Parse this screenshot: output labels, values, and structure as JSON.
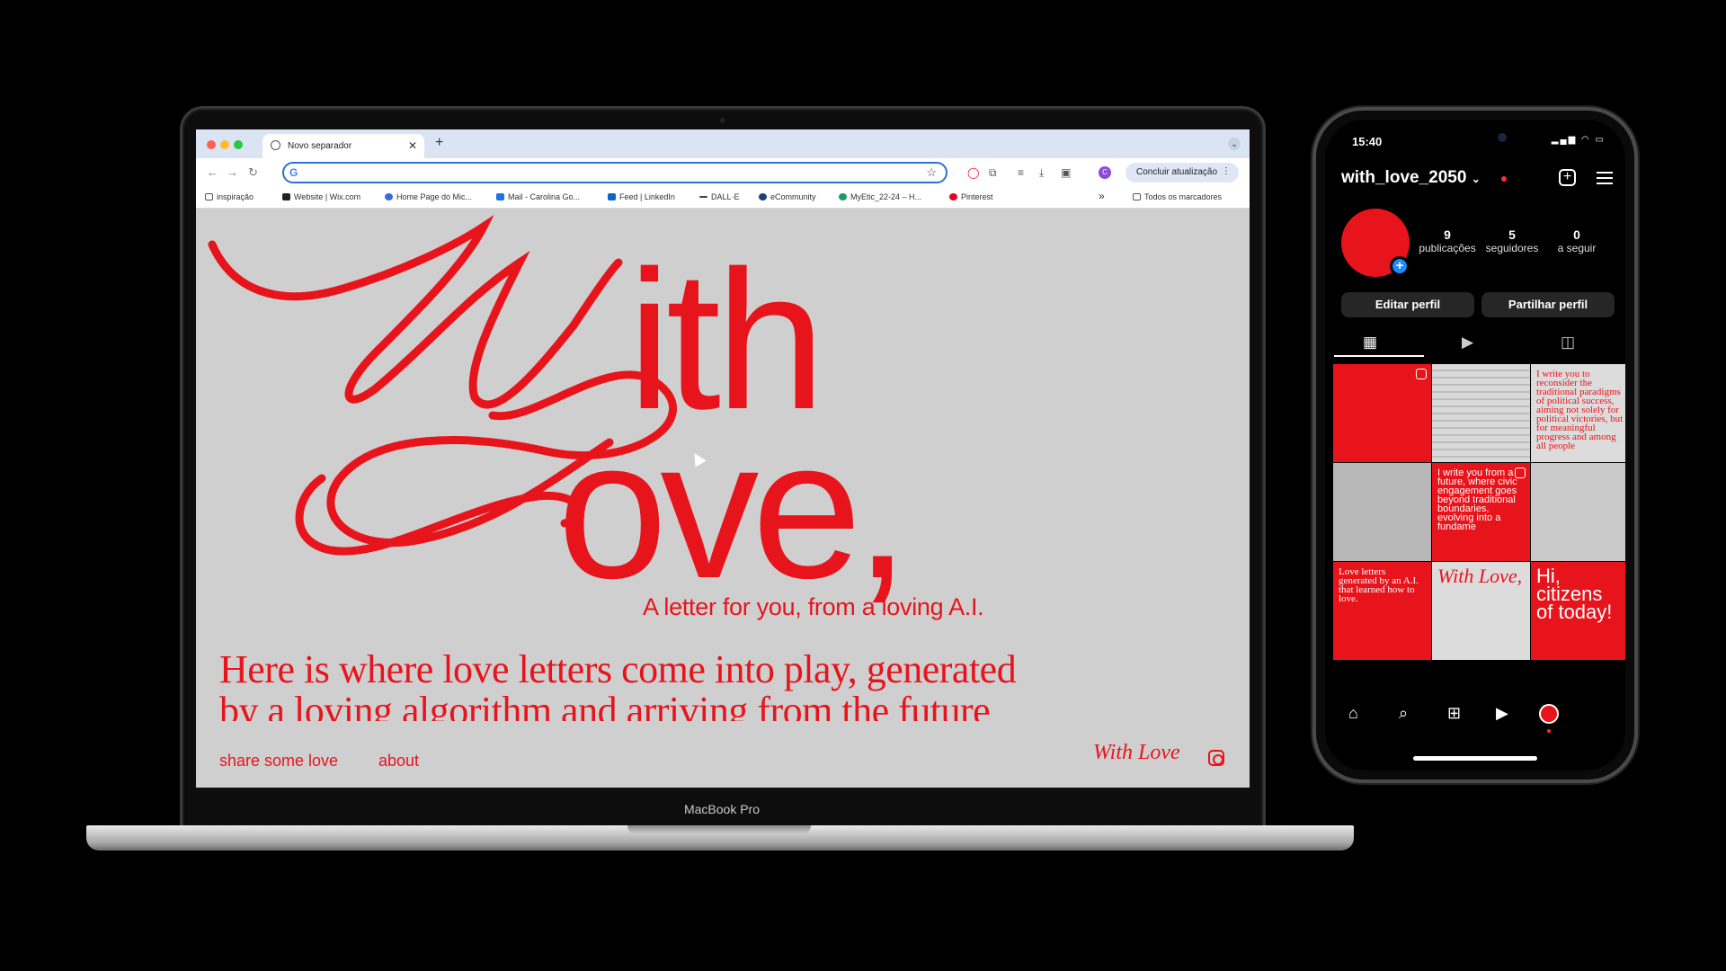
{
  "laptop": {
    "model_label": "MacBook Pro",
    "browser": {
      "tab_title": "Novo separador",
      "update_button": "Concluir atualização",
      "profile_initial": "C",
      "bookmarks": [
        "inspiração",
        "Website | Wix.com",
        "Home Page do Mic...",
        "Mail - Carolina Go...",
        "Feed | LinkedIn",
        "DALL·E",
        "eCommunity",
        "MyEtic_22-24 – H...",
        "Pinterest"
      ],
      "bookmarks_overflow": "»",
      "all_bookmarks": "Todos os marcadores"
    },
    "site": {
      "hero_word_top": "ith",
      "hero_word_bottom": "ove,",
      "subtitle": "A letter for you, from a loving A.I.",
      "intro_text": "Here is where love letters come into play, generated by a loving algorithm and arriving from the future",
      "nav_share": "share some love",
      "nav_about": "about",
      "mini_logo": "With Love,"
    }
  },
  "phone": {
    "time": "15:40",
    "username": "with_love_2050",
    "stats": [
      {
        "num": "9",
        "label": "publicações"
      },
      {
        "num": "5",
        "label": "seguidores"
      },
      {
        "num": "0",
        "label": "a seguir"
      }
    ],
    "edit_profile": "Editar perfil",
    "share_profile": "Partilhar perfil",
    "posts": [
      {
        "text": "",
        "style": "red"
      },
      {
        "text": "",
        "style": "light"
      },
      {
        "text": "I write you to reconsider the traditional paradigms of political success, aiming not solely for political victories, but for meaningful progress and among all people",
        "style": "light"
      },
      {
        "text": "",
        "style": "light"
      },
      {
        "text": "I write you from a future, where civic engagement goes beyond traditional boundaries, evolving into a fundame",
        "style": "red"
      },
      {
        "text": "",
        "style": "light"
      },
      {
        "text": "Love letters generated by an A.I. that learned how to love.",
        "style": "red"
      },
      {
        "text": "With Love,",
        "style": "light"
      },
      {
        "text": "Hi, citizens of today!",
        "style": "red"
      }
    ]
  },
  "colors": {
    "brand_red": "#e8141c",
    "page_bg": "#cfcfcf",
    "instagram_blue": "#1c8cff"
  }
}
